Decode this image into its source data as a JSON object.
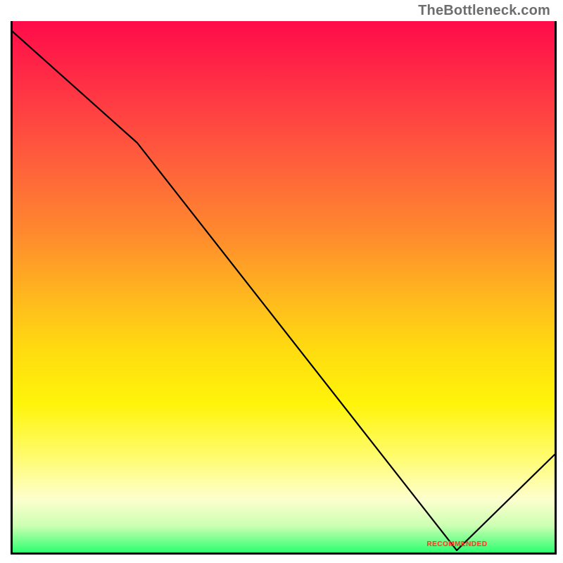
{
  "attribution": "TheBottleneck.com",
  "marker_label": "RECOMMENDED",
  "chart_data": {
    "type": "line",
    "title": "",
    "xlabel": "",
    "ylabel": "",
    "xlim": [
      0,
      100
    ],
    "ylim": [
      0,
      100
    ],
    "x": [
      0,
      23,
      82,
      100
    ],
    "values": [
      98,
      77,
      0,
      18
    ],
    "note": "Values read from unlabeled heat-gradient axes; y=0 is the green bottom edge (recommended), y=100 the red top edge.",
    "marker": {
      "x": 82,
      "y": 0,
      "label": "RECOMMENDED"
    }
  }
}
